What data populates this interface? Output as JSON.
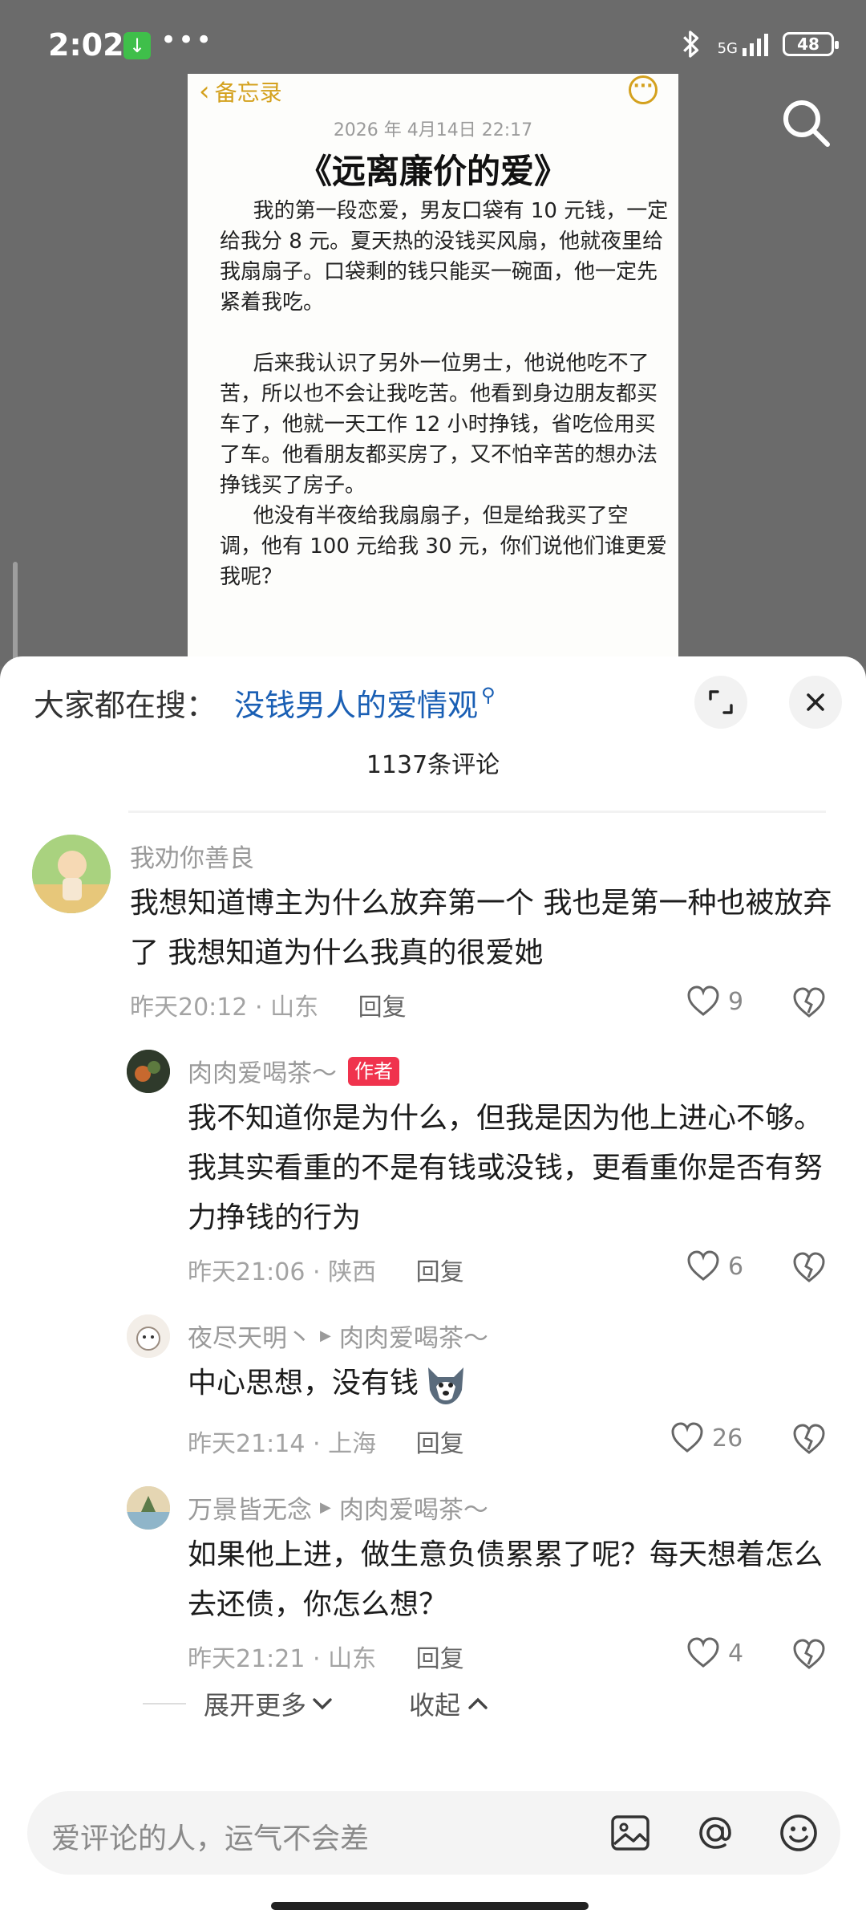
{
  "status_bar": {
    "time": "2:02",
    "network": "5G",
    "battery": "48"
  },
  "memo": {
    "back_label": "备忘录",
    "date": "2026 年 4月14日 22:17",
    "title": "《远离廉价的爱》",
    "paragraphs": [
      "我的第一段恋爱，男友口袋有 10 元钱，一定给我分 8 元。夏天热的没钱买风扇，他就夜里给我扇扇子。口袋剩的钱只能买一碗面，他一定先紧着我吃。",
      "后来我认识了另外一位男士，他说他吃不了苦，所以也不会让我吃苦。他看到身边朋友都买车了，他就一天工作 12 小时挣钱，省吃俭用买了车。他看朋友都买房了，又不怕辛苦的想办法挣钱买了房子。",
      "他没有半夜给我扇扇子，但是给我买了空调，他有 100 元给我 30 元，你们说他们谁更爱我呢？"
    ]
  },
  "sheet": {
    "hot_search_label": "大家都在搜：",
    "hot_search_link": "没钱男人的爱情观",
    "comment_count": "1137条评论",
    "comments": [
      {
        "user": "我劝你善良",
        "text": "我想知道博主为什么放弃第一个 我也是第一种也被放弃了 我想知道为什么我真的很爱她",
        "time": "昨天20:12",
        "location": "山东",
        "reply": "回复",
        "likes": "9"
      },
      {
        "user": "肉肉爱喝茶～",
        "author_tag": "作者",
        "text": "我不知道你是为什么，但我是因为他上进心不够。我其实看重的不是有钱或没钱，更看重你是否有努力挣钱的行为",
        "time": "昨天21:06",
        "location": "陕西",
        "reply": "回复",
        "likes": "6"
      },
      {
        "user": "夜尽天明丶",
        "reply_to": "肉肉爱喝茶～",
        "text": "中心思想，没有钱",
        "time": "昨天21:14",
        "location": "上海",
        "reply": "回复",
        "likes": "26"
      },
      {
        "user": "万景皆无念",
        "reply_to": "肉肉爱喝茶～",
        "text": "如果他上进，做生意负债累累了呢？每天想着怎么去还债，你怎么想？",
        "time": "昨天21:21",
        "location": "山东",
        "reply": "回复",
        "likes": "4"
      }
    ],
    "expand_more": "展开更多",
    "collapse": "收起",
    "input_placeholder": "爱评论的人，运气不会差"
  }
}
